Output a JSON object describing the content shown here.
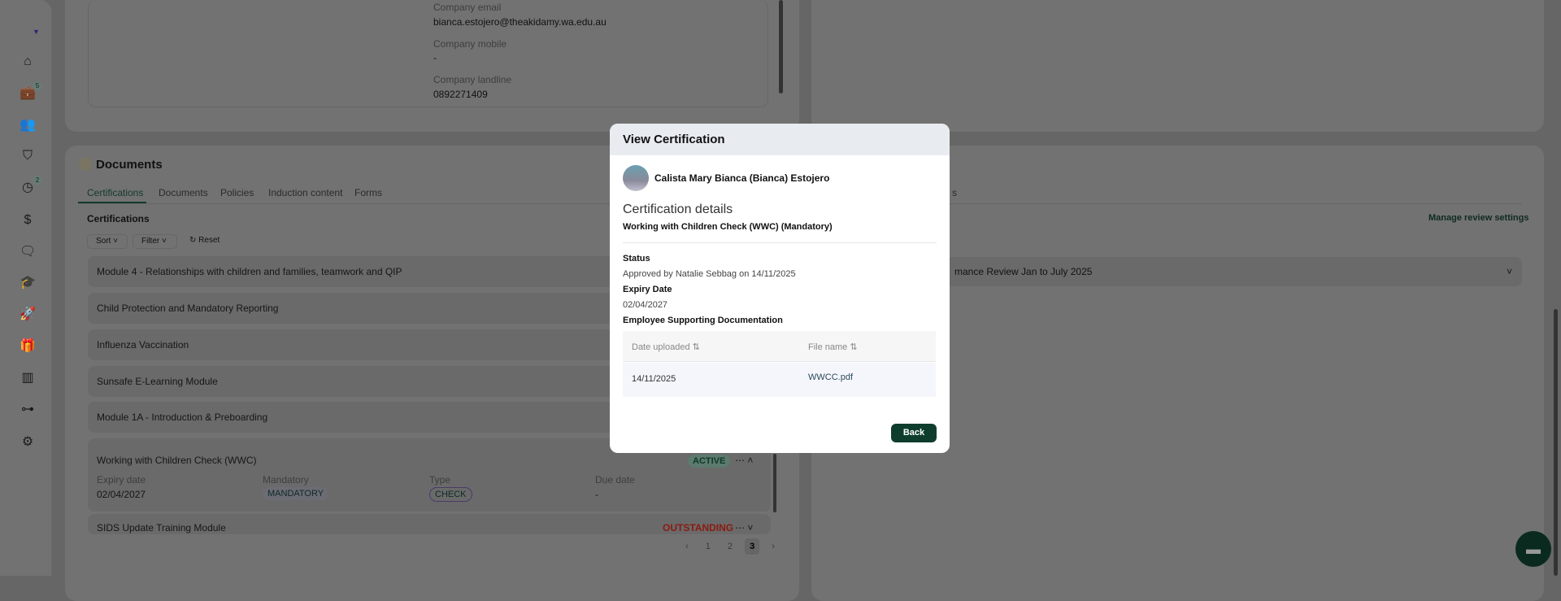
{
  "sidebar": {
    "items": [
      "home",
      "briefcase",
      "people",
      "shield-check",
      "clock",
      "dollar",
      "chat",
      "graduation-cap",
      "rocket",
      "gift",
      "bar-chart",
      "org-chart",
      "gear"
    ],
    "badges": {
      "briefcase": "5",
      "clock": "2"
    }
  },
  "contact": {
    "email_label": "Company email",
    "email": "bianca.estojero@theakidamy.wa.edu.au",
    "mobile_label": "Company mobile",
    "mobile": "-",
    "landline_label": "Company landline",
    "landline": "0892271409"
  },
  "documents": {
    "title": "Documents",
    "tabs": [
      "Certifications",
      "Documents",
      "Policies",
      "Induction content",
      "Forms"
    ],
    "section": "Certifications",
    "sort": "Sort",
    "filter": "Filter",
    "reset": "Reset",
    "rows": [
      "Module 4 - Relationships with children and families, teamwork and QIP",
      "Child Protection and Mandatory Reporting",
      "Influenza Vaccination",
      "Sunsafe E-Learning Module",
      "Module 1A - Introduction & Preboarding"
    ],
    "expanded": {
      "title": "Working with Children Check (WWC)",
      "status": "ACTIVE",
      "expiry_label": "Expiry date",
      "expiry": "02/04/2027",
      "mandatory_label": "Mandatory",
      "mandatory": "MANDATORY",
      "type_label": "Type",
      "type": "CHECK",
      "due_label": "Due date",
      "due": "-"
    },
    "last": {
      "title": "SIDS Update Training Module",
      "status": "OUTSTANDING"
    },
    "pages": [
      "1",
      "2",
      "3"
    ],
    "current_page": "3"
  },
  "review": {
    "tab_fragment": "s",
    "manage": "Manage review settings",
    "item": "mance Review Jan to July 2025"
  },
  "modal": {
    "title": "View Certification",
    "name": "Calista Mary Bianca (Bianca) Estojero",
    "details_heading": "Certification details",
    "cert": "Working with Children Check (WWC) (Mandatory)",
    "status_label": "Status",
    "status": "Approved by Natalie Sebbag on 14/11/2025",
    "expiry_label": "Expiry Date",
    "expiry": "02/04/2027",
    "docs_label": "Employee Supporting Documentation",
    "col_date": "Date uploaded",
    "col_file": "File name",
    "date": "14/11/2025",
    "file": "WWCC.pdf",
    "back": "Back"
  },
  "colors": {
    "accent": "#0e3d2e",
    "outstanding": "#c0392b",
    "active": "#2a8a6a"
  }
}
